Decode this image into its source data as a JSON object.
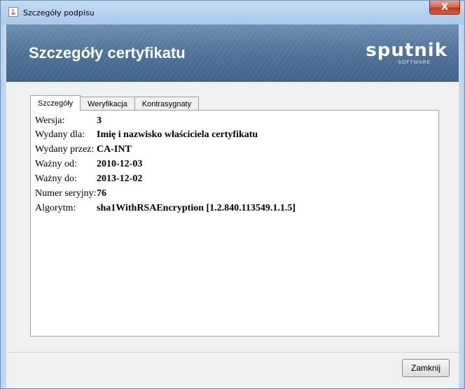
{
  "window": {
    "title": "Szczegóły podpisu",
    "close_label": "X"
  },
  "banner": {
    "heading": "Szczegóły certyfikatu",
    "logo": "sputnik",
    "logo_sub": "SOFTWARE"
  },
  "tabs": [
    {
      "label": "Szczegóły",
      "active": true
    },
    {
      "label": "Weryfikacja",
      "active": false
    },
    {
      "label": "Kontrasygnaty",
      "active": false
    }
  ],
  "details": [
    {
      "key": "Wersja:",
      "value": "3"
    },
    {
      "key": "Wydany dla:",
      "value": "Imię i nazwisko właściciela certyfikatu"
    },
    {
      "key": "Wydany przez:",
      "value": "CA-INT"
    },
    {
      "key": "Ważny od:",
      "value": "2010-12-03"
    },
    {
      "key": "Ważny do:",
      "value": "2013-12-02"
    },
    {
      "key": "Numer seryjny:",
      "value": "76"
    },
    {
      "key": "Algorytm:",
      "value": "sha1WithRSAEncryption [1.2.840.113549.1.1.5]"
    }
  ],
  "footer": {
    "close_button": "Zamknij"
  }
}
